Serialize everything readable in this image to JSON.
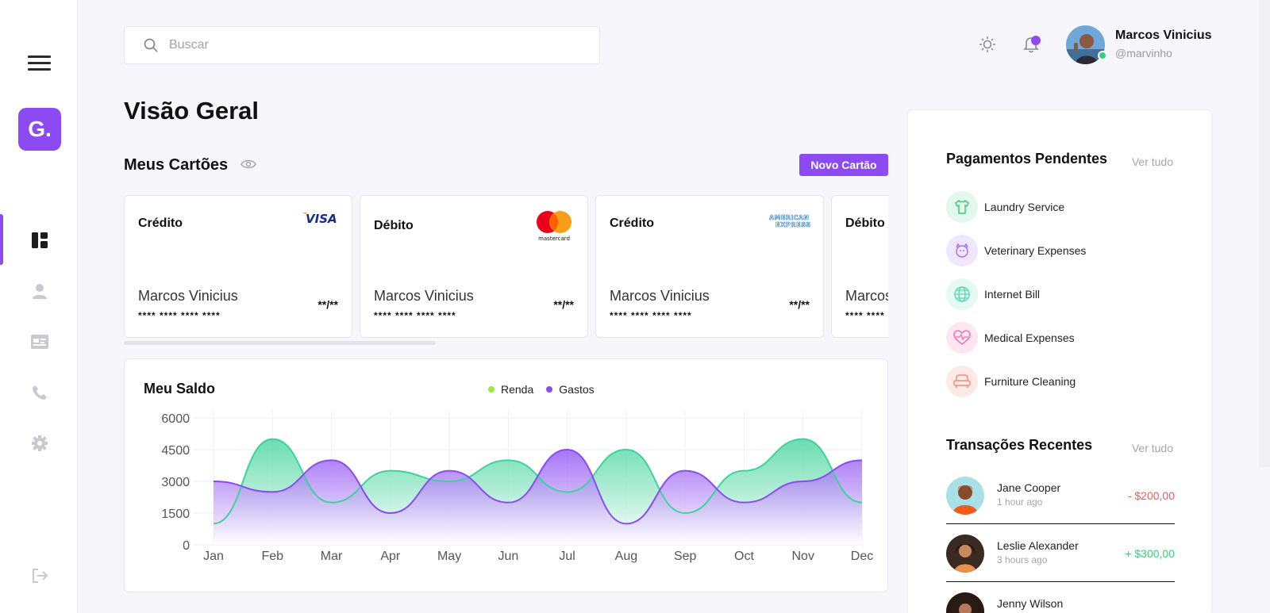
{
  "search": {
    "placeholder": "Buscar"
  },
  "user": {
    "name": "Marcos Vinicius",
    "handle": "@marvinho"
  },
  "sidebar": {
    "logo": "G."
  },
  "page": {
    "title": "Visão Geral"
  },
  "cards_section": {
    "title": "Meus Cartões",
    "new_card_label": "Novo Cartão",
    "cards": [
      {
        "type": "Crédito",
        "brand": "visa",
        "brand_text": "VISA",
        "holder": "Marcos Vinicius",
        "number": "**** **** **** ****",
        "exp": "**/**"
      },
      {
        "type": "Débito",
        "brand": "mastercard",
        "brand_text": "mastercard",
        "holder": "Marcos Vinicius",
        "number": "**** **** **** ****",
        "exp": "**/**"
      },
      {
        "type": "Crédito",
        "brand": "amex",
        "brand_text": "AMERICAN EXPRESS",
        "holder": "Marcos Vinicius",
        "number": "**** **** **** ****",
        "exp": "**/**"
      },
      {
        "type": "Débito",
        "brand": "",
        "brand_text": "",
        "holder": "Marcos Vinicius",
        "number": "**** **** **** ****",
        "exp": "**/**"
      }
    ]
  },
  "balance": {
    "title": "Meu Saldo",
    "legend": [
      {
        "label": "Renda",
        "color": "#9be93a"
      },
      {
        "label": "Gastos",
        "color": "#8c4bf2"
      }
    ]
  },
  "chart_data": {
    "type": "area",
    "title": "Meu Saldo",
    "categories": [
      "Jan",
      "Feb",
      "Mar",
      "Apr",
      "May",
      "Jun",
      "Jul",
      "Aug",
      "Sep",
      "Oct",
      "Nov",
      "Dec"
    ],
    "series": [
      {
        "name": "Renda",
        "color": "#3ed39a",
        "values": [
          1000,
          5000,
          2000,
          3500,
          3000,
          4000,
          2500,
          4500,
          1500,
          3500,
          5000,
          2000
        ]
      },
      {
        "name": "Gastos",
        "color": "#8c4bf2",
        "values": [
          3000,
          2500,
          4000,
          1500,
          3500,
          2000,
          4500,
          1000,
          3500,
          2000,
          3000,
          4000
        ]
      }
    ],
    "yticks": [
      0,
      1500,
      3000,
      4500,
      6000
    ],
    "ylim": [
      0,
      6000
    ],
    "grid": true,
    "legend_position": "top-center"
  },
  "pending": {
    "title": "Pagamentos Pendentes",
    "see_all": "Ver tudo",
    "items": [
      {
        "label": "Laundry Service",
        "icon": "shirt-icon",
        "color": "#3ec97a",
        "bg": "#e3f8ec"
      },
      {
        "label": "Veterinary Expenses",
        "icon": "pet-icon",
        "color": "#a374f0",
        "bg": "#efe6fd"
      },
      {
        "label": "Internet Bill",
        "icon": "globe-icon",
        "color": "#5ad8b3",
        "bg": "#e6faf3"
      },
      {
        "label": "Medical Expenses",
        "icon": "heart-pulse-icon",
        "color": "#f26fb4",
        "bg": "#fde6f1"
      },
      {
        "label": "Furniture Cleaning",
        "icon": "sofa-icon",
        "color": "#f08a7a",
        "bg": "#fdeae7"
      }
    ]
  },
  "transactions": {
    "title": "Transações Recentes",
    "see_all": "Ver tudo",
    "items": [
      {
        "name": "Jane Cooper",
        "time": "1 hour ago",
        "amount": "- $200,00",
        "color": "#f25a5a"
      },
      {
        "name": "Leslie Alexander",
        "time": "3 hours ago",
        "amount": "+ $300,00",
        "color": "#35d17a"
      },
      {
        "name": "Jenny Wilson",
        "time": "",
        "amount": "",
        "color": "#222222"
      }
    ]
  }
}
